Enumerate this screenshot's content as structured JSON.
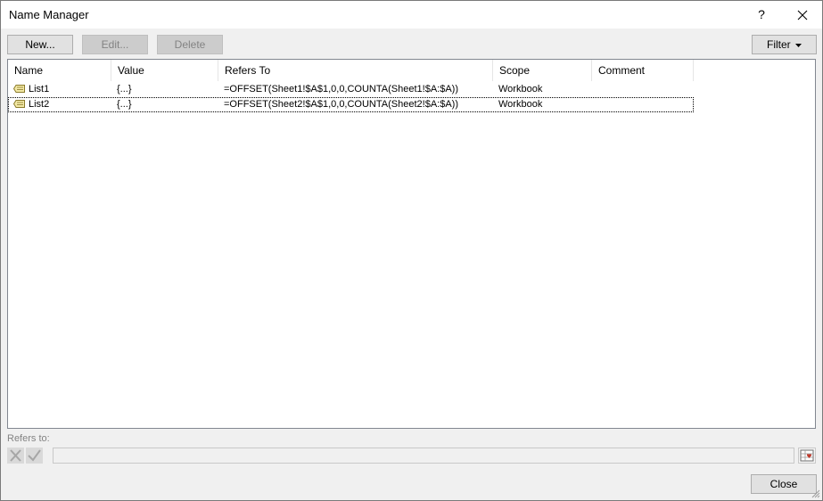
{
  "window": {
    "title": "Name Manager",
    "help": "?",
    "close": "✕"
  },
  "toolbar": {
    "new_label": "New...",
    "edit_label": "Edit...",
    "delete_label": "Delete",
    "filter_label": "Filter"
  },
  "list": {
    "columns": [
      "Name",
      "Value",
      "Refers To",
      "Scope",
      "Comment"
    ],
    "rows": [
      {
        "name": "List1",
        "value": "{...}",
        "refers_to": "=OFFSET(Sheet1!$A$1,0,0,COUNTA(Sheet1!$A:$A))",
        "scope": "Workbook",
        "comment": "",
        "selected": false
      },
      {
        "name": "List2",
        "value": "{...}",
        "refers_to": "=OFFSET(Sheet2!$A$1,0,0,COUNTA(Sheet2!$A:$A))",
        "scope": "Workbook",
        "comment": "",
        "selected": true
      }
    ]
  },
  "refers_to": {
    "label": "Refers to:",
    "value": ""
  },
  "footer": {
    "close_label": "Close"
  },
  "icons": {
    "name_icon": "named-range-icon",
    "cancel_icon": "cancel-x-icon",
    "confirm_icon": "checkmark-icon",
    "collapse_icon": "range-picker-icon"
  }
}
